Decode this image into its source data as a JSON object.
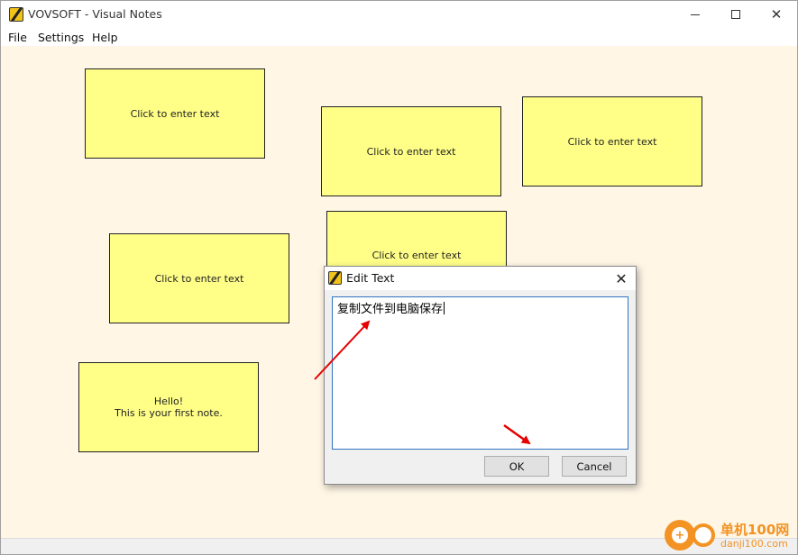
{
  "app": {
    "title": "VOVSOFT - Visual Notes",
    "icon": "app-pen-icon"
  },
  "menu": {
    "items": [
      "File",
      "Settings",
      "Help"
    ]
  },
  "notes": [
    {
      "text": "Click to enter text"
    },
    {
      "text": "Click to enter text"
    },
    {
      "text": "Click to enter text"
    },
    {
      "text": "Click to enter text"
    },
    {
      "text": "Click to enter text"
    },
    {
      "text": "Hello!\nThis is your first note."
    }
  ],
  "dialog": {
    "title": "Edit Text",
    "text_value": "复制文件到电脑保存",
    "ok_label": "OK",
    "cancel_label": "Cancel"
  },
  "watermark": {
    "text1": "单机100网",
    "text2": "danji100.com",
    "logo_char": "+"
  },
  "colors": {
    "canvas": "#fff6e6",
    "note": "#ffff88",
    "accent": "#2f74c0",
    "arrow": "#e60000",
    "watermark": "#f39323"
  }
}
